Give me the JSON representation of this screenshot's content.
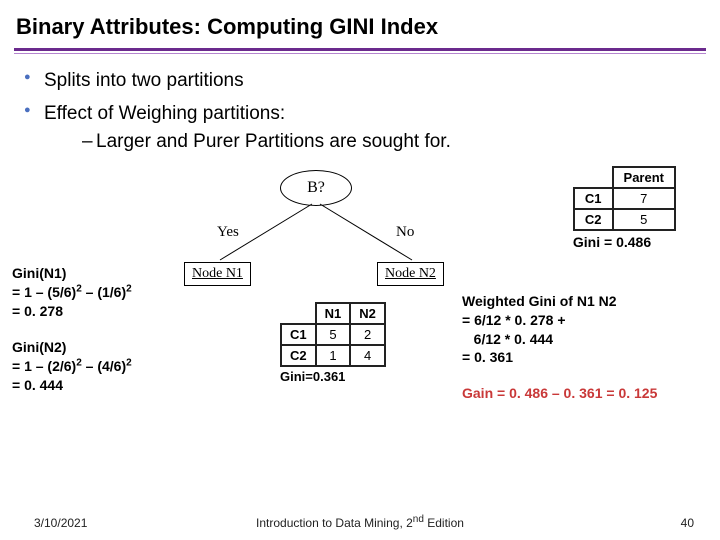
{
  "title": "Binary Attributes: Computing GINI Index",
  "bullets": {
    "b1": "Splits into two partitions",
    "b2": "Effect of Weighing partitions:",
    "b2sub": "Larger and Purer Partitions are sought for."
  },
  "tree": {
    "root": "B?",
    "yes": "Yes",
    "no": "No",
    "node1": "Node N1",
    "node2": "Node N2"
  },
  "parent_table": {
    "header": "Parent",
    "r1c1": "C1",
    "r1c2": "7",
    "r2c1": "C2",
    "r2c2": "5",
    "gini": "Gini = 0.486"
  },
  "split_table": {
    "h1": "N1",
    "h2": "N2",
    "r1c1": "C1",
    "r1c2": "5",
    "r1c3": "2",
    "r2c1": "C2",
    "r2c2": "1",
    "r2c3": "4",
    "gini": "Gini=0.361"
  },
  "gini_n1": {
    "l1": "Gini(N1)",
    "l2_pre": "= 1 – (5/6)",
    "l2_mid": " – (1/6)",
    "l3": "= 0. 278"
  },
  "gini_n2": {
    "l1": "Gini(N2)",
    "l2_pre": "= 1 – (2/6)",
    "l2_mid": " – (4/6)",
    "l3": "= 0. 444"
  },
  "weighted": {
    "l1": "Weighted Gini of N1 N2",
    "l2": "= 6/12 * 0. 278 +",
    "l3": "   6/12 * 0. 444",
    "l4": "= 0. 361"
  },
  "gain": "Gain = 0. 486 – 0. 361 = 0. 125",
  "sup2": "2",
  "footer": {
    "date": "3/10/2021",
    "mid_pre": "Introduction to Data Mining, 2",
    "mid_sup": "nd",
    "mid_post": " Edition",
    "page": "40"
  },
  "chart_data": {
    "type": "table",
    "parent_counts": {
      "C1": 7,
      "C2": 5,
      "gini": 0.486
    },
    "split": {
      "N1": {
        "C1": 5,
        "C2": 1,
        "weight": 0.5
      },
      "N2": {
        "C1": 2,
        "C2": 4,
        "weight": 0.5
      }
    },
    "gini_N1": 0.278,
    "gini_N2": 0.444,
    "weighted_gini": 0.361,
    "gain": 0.125
  }
}
